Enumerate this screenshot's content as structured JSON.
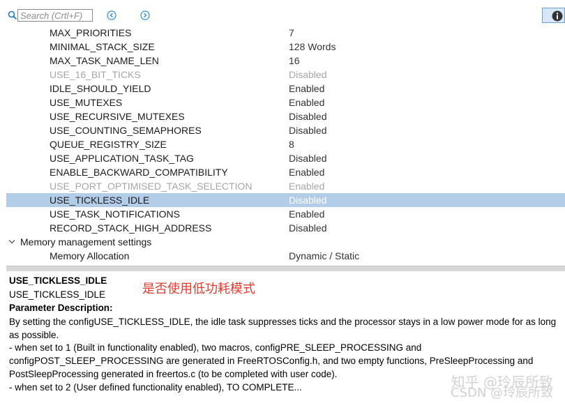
{
  "toolbar": {
    "search_placeholder": "Search (Crtl+F)",
    "search_value": "",
    "back_icon": "circle-chevron-left",
    "forward_icon": "circle-chevron-right",
    "info_icon": "info-circle"
  },
  "params": [
    {
      "name": "MAX_PRIORITIES",
      "value": "7",
      "disabled": false
    },
    {
      "name": "MINIMAL_STACK_SIZE",
      "value": "128 Words",
      "disabled": false
    },
    {
      "name": "MAX_TASK_NAME_LEN",
      "value": "16",
      "disabled": false
    },
    {
      "name": "USE_16_BIT_TICKS",
      "value": "Disabled",
      "disabled": true
    },
    {
      "name": "IDLE_SHOULD_YIELD",
      "value": "Enabled",
      "disabled": false
    },
    {
      "name": "USE_MUTEXES",
      "value": "Enabled",
      "disabled": false
    },
    {
      "name": "USE_RECURSIVE_MUTEXES",
      "value": "Disabled",
      "disabled": false
    },
    {
      "name": "USE_COUNTING_SEMAPHORES",
      "value": "Disabled",
      "disabled": false
    },
    {
      "name": "QUEUE_REGISTRY_SIZE",
      "value": "8",
      "disabled": false
    },
    {
      "name": "USE_APPLICATION_TASK_TAG",
      "value": "Disabled",
      "disabled": false
    },
    {
      "name": "ENABLE_BACKWARD_COMPATIBILITY",
      "value": "Enabled",
      "disabled": false
    },
    {
      "name": "USE_PORT_OPTIMISED_TASK_SELECTION",
      "value": "Enabled",
      "disabled": true
    },
    {
      "name": "USE_TICKLESS_IDLE",
      "value": "Disabled",
      "disabled": false,
      "selected": true
    },
    {
      "name": "USE_TASK_NOTIFICATIONS",
      "value": "Enabled",
      "disabled": false
    },
    {
      "name": "RECORD_STACK_HIGH_ADDRESS",
      "value": "Disabled",
      "disabled": false
    }
  ],
  "memory_group": {
    "label": "Memory management settings",
    "items": [
      {
        "name": "Memory Allocation",
        "value": "Dynamic / Static"
      }
    ]
  },
  "description": {
    "title": "USE_TICKLESS_IDLE",
    "name": "USE_TICKLESS_IDLE",
    "heading": "Parameter Description:",
    "para1": "By setting the configUSE_TICKLESS_IDLE, the idle task suppresses ticks and the processor stays in a low power mode for as long as possible.",
    "para2": "- when set to 1 (Built in functionality enabled), two macros, configPRE_SLEEP_PROCESSING and configPOST_SLEEP_PROCESSING are generated in FreeRTOSConfig.h, and two empty functions, PreSleepProcessing and PostSleepProcessing generated in freertos.c (to be completed with user code).",
    "para3": "- when set to 2 (User defined functionality enabled), TO COMPLETE..."
  },
  "annotation": "是否使用低功耗模式",
  "watermark": "知乎 @玲辰所致",
  "watermark_line2": "CSDN @玲辰所致",
  "colors": {
    "selection": "#b3cde8",
    "annotation": "#e23b2e",
    "disabled_text": "#a6a6a6"
  }
}
